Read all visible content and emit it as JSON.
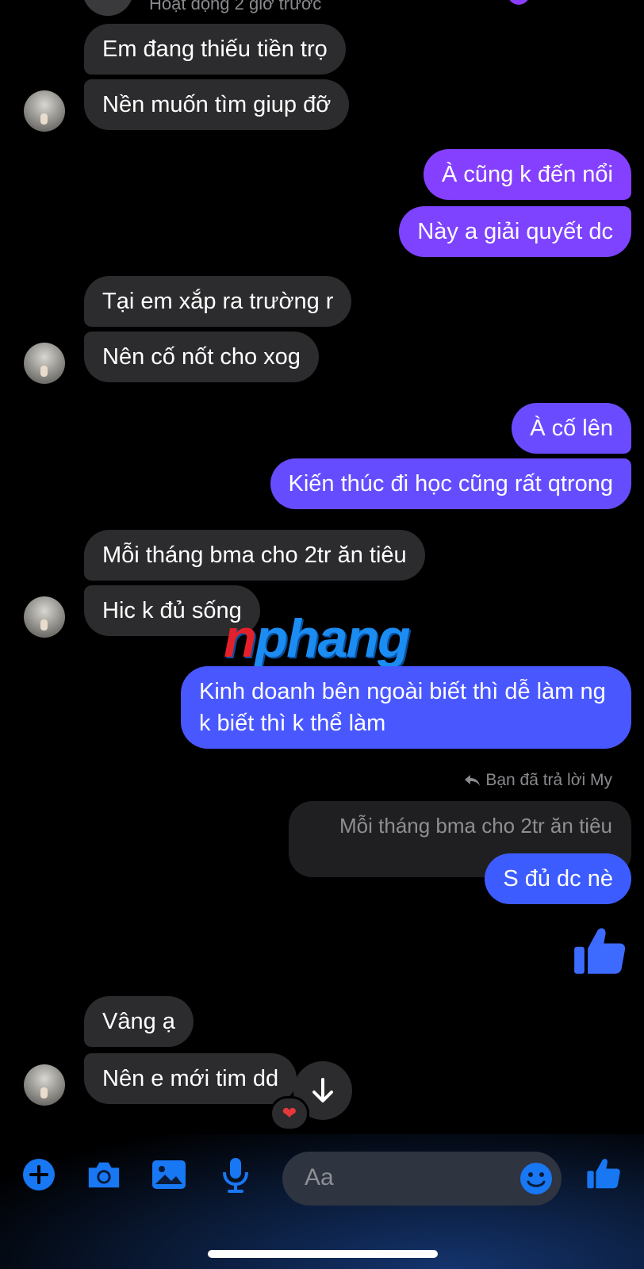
{
  "header": {
    "status": "Hoạt động 2 giờ trước"
  },
  "messages": {
    "m1": "Em đang thiếu tiền trọ",
    "m2": "Nền muốn tìm giup đỡ",
    "m3": "À cũng k đến nổi",
    "m4": "Này a giải quyết dc",
    "m5": "Tại em xắp ra trường r",
    "m6": "Nên cố nốt cho xog",
    "m7": "À cố lên",
    "m8": "Kiến thúc đi học cũng rất qtrong",
    "m9": "Mỗi tháng bma cho 2tr ăn tiêu",
    "m10": "Hic k đủ sống",
    "m11": "Kinh doanh bên ngoài biết thì dễ làm ng k biết thì k thể làm",
    "m12": "S đủ dc nè",
    "m13": "Vâng ạ",
    "m14": "Nên e mới tim dd"
  },
  "reply": {
    "meta": "Bạn đã trả lời My",
    "quote": "Mỗi tháng bma cho 2tr ăn tiêu"
  },
  "reaction": "❤",
  "watermark": {
    "first": "n",
    "rest": "phang"
  },
  "composer": {
    "placeholder": "Aa"
  },
  "colors": {
    "incoming": "#2c2c2e",
    "outgoing_purple": "#8b3dff",
    "outgoing_mid": "#6a4dff",
    "outgoing_blue": "#3d5cff",
    "accent_blue": "#1877f2"
  },
  "icons": [
    "plus-icon",
    "camera-icon",
    "image-icon",
    "microphone-icon",
    "emoji-icon",
    "like-icon",
    "arrow-down-icon",
    "reply-icon"
  ]
}
